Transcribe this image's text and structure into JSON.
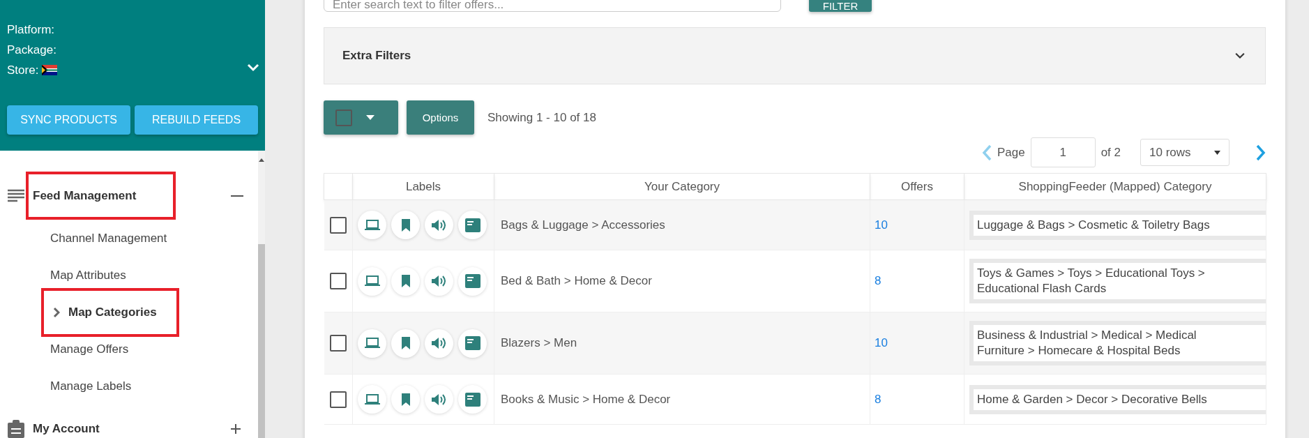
{
  "store_header": {
    "lines": [
      {
        "label": "Platform:",
        "kind": "text"
      },
      {
        "label": "Package:",
        "kind": "text"
      },
      {
        "label": "Store:",
        "kind": "flag"
      }
    ],
    "expanded": false,
    "buttons": [
      "SYNC PRODUCTS",
      "REBUILD FEEDS"
    ]
  },
  "nav": {
    "items": [
      {
        "label": "Feed Management",
        "expanded": true,
        "highlighted": true,
        "children": [
          {
            "label": "Channel Management",
            "selected": false,
            "highlighted": false
          },
          {
            "label": "Map Attributes",
            "selected": false,
            "highlighted": false
          },
          {
            "label": "Map Categories",
            "selected": true,
            "highlighted": true
          },
          {
            "label": "Manage Offers",
            "selected": false,
            "highlighted": false
          },
          {
            "label": "Manage Labels",
            "selected": false,
            "highlighted": false
          }
        ]
      },
      {
        "label": "My Account",
        "expanded": false,
        "highlighted": false
      }
    ]
  },
  "search": {
    "placeholder": "Enter search text to filter offers...",
    "button": "FILTER"
  },
  "extra_filters": {
    "title": "Extra Filters",
    "expanded": false
  },
  "toolbar": {
    "select_all_checked": false,
    "options": "Options",
    "showing": "Showing 1 - 10 of 18"
  },
  "pagination": {
    "page_label": "Page",
    "page": "1",
    "of": "of 2",
    "rows": "10 rows"
  },
  "table": {
    "columns": [
      "Labels",
      "Your Category",
      "Offers",
      "ShoppingFeeder (Mapped) Category"
    ],
    "rows": [
      {
        "checked": false,
        "category": "Bags & Luggage > Accessories",
        "offers": "10",
        "mapped": "Luggage & Bags > Cosmetic & Toiletry Bags"
      },
      {
        "checked": false,
        "category": "Bed & Bath > Home & Decor",
        "offers": "8",
        "mapped": "Toys & Games > Toys > Educational Toys > Educational Flash Cards"
      },
      {
        "checked": false,
        "category": "Blazers > Men",
        "offers": "10",
        "mapped": "Business & Industrial > Medical > Medical Furniture > Homecare & Hospital Beds"
      },
      {
        "checked": false,
        "category": "Books & Music > Home & Decor",
        "offers": "8",
        "mapped": "Home & Garden > Decor > Decorative Bells"
      }
    ]
  }
}
